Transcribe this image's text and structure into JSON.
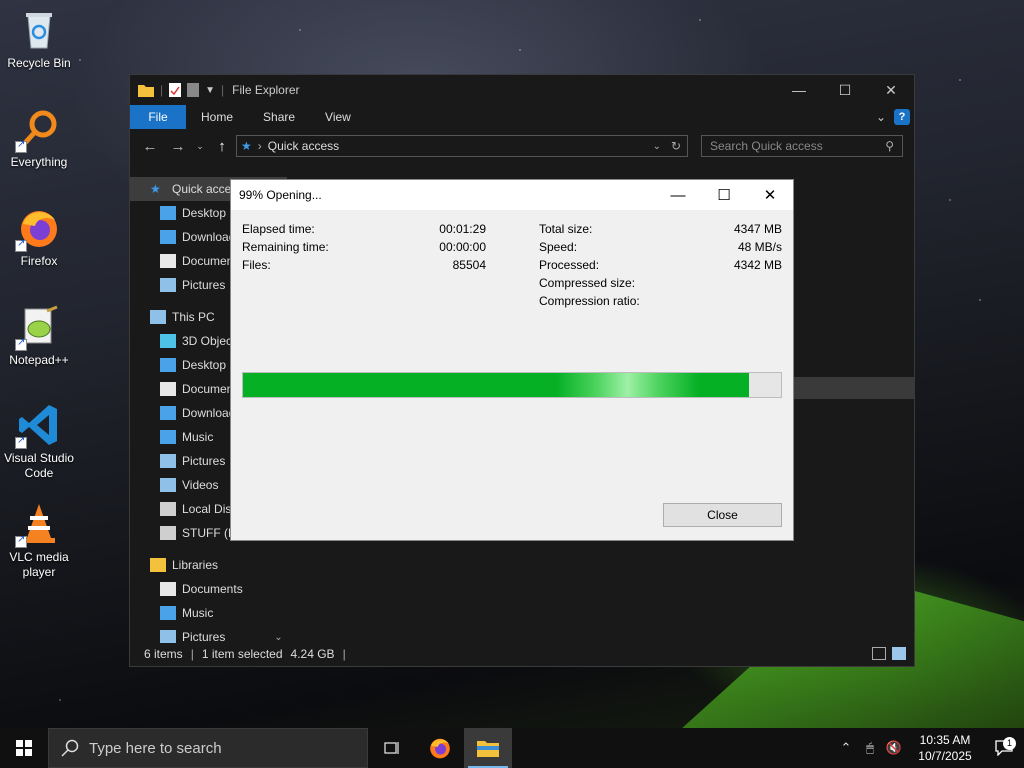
{
  "desktop": {
    "icons": [
      {
        "label": "Recycle Bin"
      },
      {
        "label": "Everything"
      },
      {
        "label": "Firefox"
      },
      {
        "label": "Notepad++"
      },
      {
        "label": "Visual Studio Code"
      },
      {
        "label": "VLC media player"
      }
    ]
  },
  "explorer": {
    "title": "File Explorer",
    "ribbon_tabs": [
      "File",
      "Home",
      "Share",
      "View"
    ],
    "address": "Quick access",
    "search_placeholder": "Search Quick access",
    "nav_items": [
      {
        "label": "Quick access",
        "icon": "star-icon",
        "selected": true
      },
      {
        "label": "Desktop",
        "icon": "desktop-folder-icon"
      },
      {
        "label": "Downloads",
        "icon": "download-icon"
      },
      {
        "label": "Documents",
        "icon": "document-icon"
      },
      {
        "label": "Pictures",
        "icon": "pictures-icon"
      },
      {
        "label": "This PC",
        "icon": "computer-icon"
      },
      {
        "label": "3D Objects",
        "icon": "cube-icon"
      },
      {
        "label": "Desktop",
        "icon": "desktop-folder-icon"
      },
      {
        "label": "Documents",
        "icon": "document-icon"
      },
      {
        "label": "Downloads",
        "icon": "download-icon"
      },
      {
        "label": "Music",
        "icon": "music-icon"
      },
      {
        "label": "Pictures",
        "icon": "pictures-icon"
      },
      {
        "label": "Videos",
        "icon": "video-icon"
      },
      {
        "label": "Local Disk",
        "icon": "drive-icon"
      },
      {
        "label": "STUFF (E:)",
        "icon": "drive-icon"
      },
      {
        "label": "Libraries",
        "icon": "library-icon"
      },
      {
        "label": "Documents",
        "icon": "document-icon"
      },
      {
        "label": "Music",
        "icon": "music-icon"
      },
      {
        "label": "Pictures",
        "icon": "pictures-icon"
      }
    ],
    "status": {
      "items": "6 items",
      "selected": "1 item selected",
      "size": "4.24 GB"
    }
  },
  "dialog": {
    "title": "99% Opening...",
    "left_stats": [
      {
        "label": "Elapsed time:",
        "value": "00:01:29"
      },
      {
        "label": "Remaining time:",
        "value": "00:00:00"
      },
      {
        "label": "Files:",
        "value": "85504"
      }
    ],
    "right_stats": [
      {
        "label": "Total size:",
        "value": "4347 MB"
      },
      {
        "label": "Speed:",
        "value": "48 MB/s"
      },
      {
        "label": "Processed:",
        "value": "4342 MB"
      },
      {
        "label": "Compressed size:",
        "value": ""
      },
      {
        "label": "Compression ratio:",
        "value": ""
      }
    ],
    "progress_percent": 94,
    "close_label": "Close"
  },
  "taskbar": {
    "search_placeholder": "Type here to search",
    "time": "10:35 AM",
    "date": "10/7/2025",
    "notification_count": "1"
  },
  "colors": {
    "accent": "#1a73c6",
    "progress": "#06b025"
  }
}
